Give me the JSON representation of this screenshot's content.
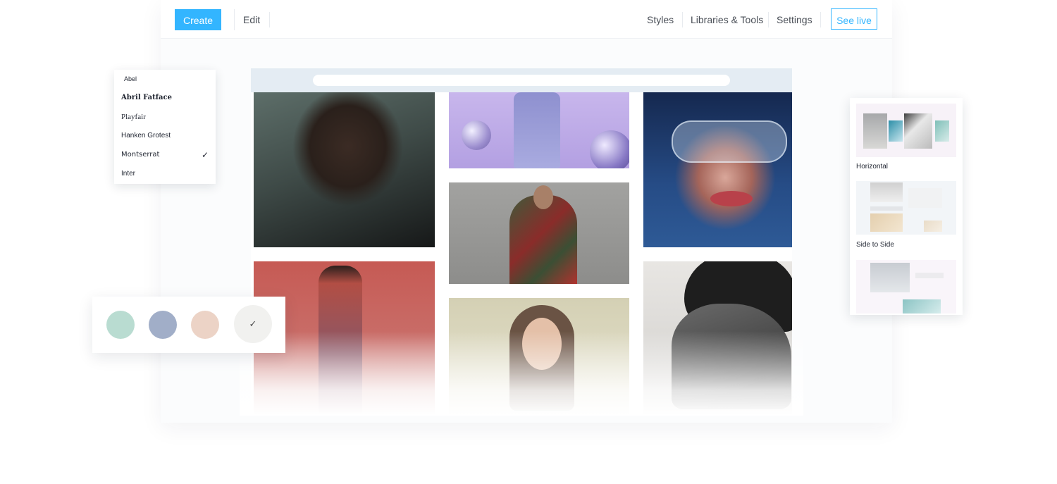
{
  "topbar": {
    "create_label": "Create",
    "edit_label": "Edit",
    "styles_label": "Styles",
    "libraries_label": "Libraries & Tools",
    "settings_label": "Settings",
    "see_live_label": "See live"
  },
  "font_menu": {
    "items": [
      "Abel",
      "Abril Fatface",
      "Playfair",
      "Hanken Grotest",
      "Montserrat",
      "Inter"
    ],
    "selected": "Montserrat",
    "check_glyph": "✓"
  },
  "swatches": {
    "colors": [
      "#b9dcd1",
      "#a1aec8",
      "#ecd3c6"
    ],
    "selected_color": "#f1f1ef",
    "check_glyph": "✓"
  },
  "layouts": {
    "items": [
      {
        "label": "Horizontal"
      },
      {
        "label": "Side to Side"
      }
    ]
  },
  "accent_color": "#33b5ff"
}
